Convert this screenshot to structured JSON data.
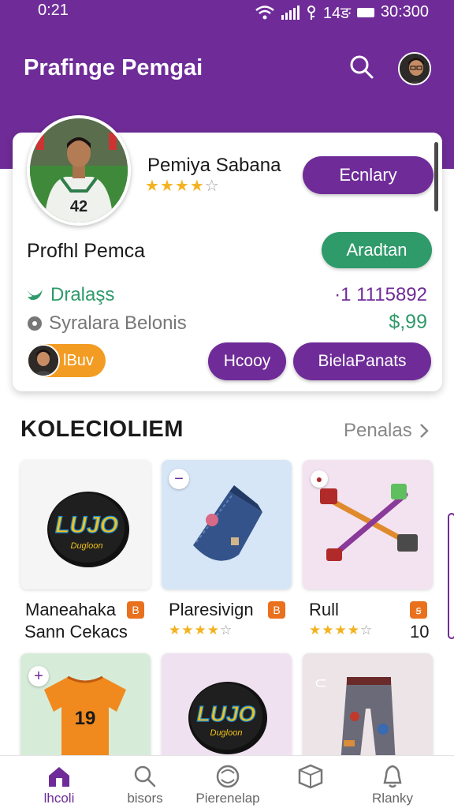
{
  "status_bar": {
    "time": "0:21",
    "battery_text": "14ङ",
    "clock_right": "30:300"
  },
  "header": {
    "title": "Prafinge Pemgai"
  },
  "profile": {
    "name": "Pemiya Sabana",
    "rating": 4,
    "rating_max": 5,
    "primary_button": "Ecnlary",
    "section_label": "Profhl Pemca",
    "green_button": "Aradtan",
    "stat1_label": "Dralaşs",
    "stat1_value": "·1 1115892",
    "stat2_label": "Syralara Belonis",
    "stat2_value": "$,99",
    "badge_text": "lBuv",
    "button_left": "Hcooy",
    "button_right": "BielaPanats",
    "jersey_number": "42"
  },
  "collection": {
    "title": "KOLECIOLIEM",
    "see_all": "Penalas",
    "products": [
      {
        "name": "Maneahaka",
        "subtitle": "Sann Cekacs",
        "badge": "B",
        "logo_text": "LUJO",
        "logo_sub": "Dugloon"
      },
      {
        "name": "Plaresivign",
        "rating": 4,
        "badge": "B",
        "corner": "−"
      },
      {
        "name": "Rull",
        "rating": 4,
        "badge": "ꞩ",
        "count": "10"
      },
      {
        "jersey_number": "19",
        "corner": "+"
      },
      {
        "logo_text": "LUJO",
        "logo_sub": "Dugloon"
      },
      {
        "corner": "⊂"
      }
    ]
  },
  "bottom_nav": [
    {
      "label": "lhcoli",
      "icon": "home-icon"
    },
    {
      "label": "bisors",
      "icon": "search-icon"
    },
    {
      "label": "Pierenelap",
      "icon": "ball-icon"
    },
    {
      "label": "",
      "icon": "box-icon"
    },
    {
      "label": "Rlanky",
      "icon": "bell-icon"
    }
  ],
  "colors": {
    "brand": "#6f2c98",
    "accent_green": "#2f9a6a",
    "star": "#f3b21f",
    "badge_orange": "#e9711e"
  }
}
